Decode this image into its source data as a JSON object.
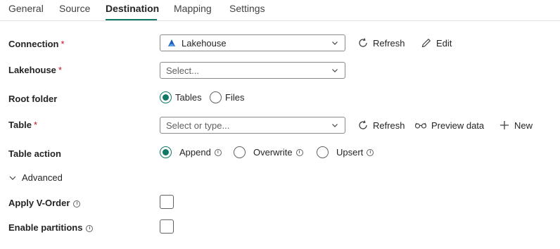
{
  "tabs": [
    {
      "label": "General"
    },
    {
      "label": "Source"
    },
    {
      "label": "Destination"
    },
    {
      "label": "Mapping"
    },
    {
      "label": "Settings"
    }
  ],
  "active_tab": "Destination",
  "required_marker": "*",
  "info_glyph": "i",
  "connection": {
    "label": "Connection",
    "value": "Lakehouse",
    "refresh_label": "Refresh",
    "edit_label": "Edit"
  },
  "lakehouse": {
    "label": "Lakehouse",
    "placeholder": "Select..."
  },
  "root_folder": {
    "label": "Root folder",
    "options": [
      {
        "label": "Tables",
        "selected": true
      },
      {
        "label": "Files",
        "selected": false
      }
    ]
  },
  "table": {
    "label": "Table",
    "placeholder": "Select or type...",
    "refresh_label": "Refresh",
    "preview_label": "Preview data",
    "new_label": "New"
  },
  "table_action": {
    "label": "Table action",
    "options": [
      {
        "label": "Append",
        "selected": true
      },
      {
        "label": "Overwrite",
        "selected": false
      },
      {
        "label": "Upsert",
        "selected": false
      }
    ]
  },
  "advanced": {
    "label": "Advanced",
    "expanded": true
  },
  "apply_v_order": {
    "label": "Apply V-Order",
    "checked": false
  },
  "enable_partitions": {
    "label": "Enable partitions",
    "checked": false
  },
  "colors": {
    "accent": "#117865",
    "required": "#c50f1f",
    "text": "#242424",
    "border": "#8a8a8a"
  }
}
